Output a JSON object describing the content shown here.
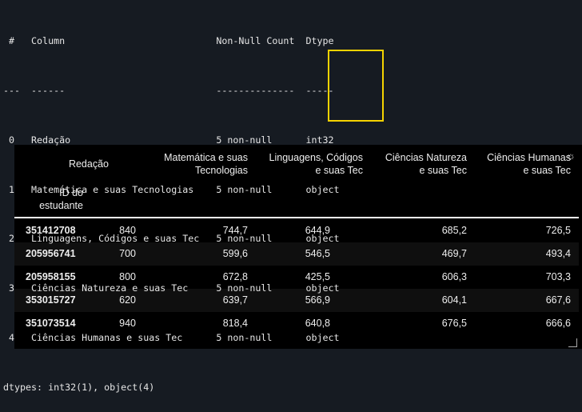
{
  "info": {
    "header": " #   Column                           Non-Null Count  Dtype ",
    "sep": "---  ------                           --------------  ----- ",
    "rows": [
      " 0   Redação                          5 non-null      int32 ",
      " 1   Matemática e suas Tecnologias    5 non-null      object",
      " 2   Linguagens, Códigos e suas Tec   5 non-null      object",
      " 3   Ciências Natureza e suas Tec     5 non-null      object",
      " 4   Ciências Humanas e suas Tec      5 non-null      object"
    ],
    "footer": "dtypes: int32(1), object(4)",
    "highlight_color": "#f5d300"
  },
  "table": {
    "index_name_1": "ID do",
    "index_name_2": "estudante",
    "columns": [
      {
        "l1": "Redação",
        "l2": ""
      },
      {
        "l1": "Matemática e suas",
        "l2": "Tecnologias"
      },
      {
        "l1": "Linguagens, Códigos",
        "l2": "e suas Tec"
      },
      {
        "l1": "Ciências Natureza",
        "l2": "e suas Tec"
      },
      {
        "l1": "Ciências Humanas",
        "l2": "e suas Tec"
      }
    ],
    "rows": [
      {
        "id": "351412708",
        "v": [
          "840",
          "744,7",
          "644,9",
          "685,2",
          "726,5"
        ]
      },
      {
        "id": "205956741",
        "v": [
          "700",
          "599,6",
          "546,5",
          "469,7",
          "493,4"
        ]
      },
      {
        "id": "205958155",
        "v": [
          "800",
          "672,8",
          "425,5",
          "606,3",
          "703,3"
        ]
      },
      {
        "id": "353015727",
        "v": [
          "620",
          "639,7",
          "566,9",
          "604,1",
          "667,6"
        ]
      },
      {
        "id": "351073514",
        "v": [
          "940",
          "818,4",
          "640,8",
          "676,5",
          "666,6"
        ]
      }
    ]
  }
}
